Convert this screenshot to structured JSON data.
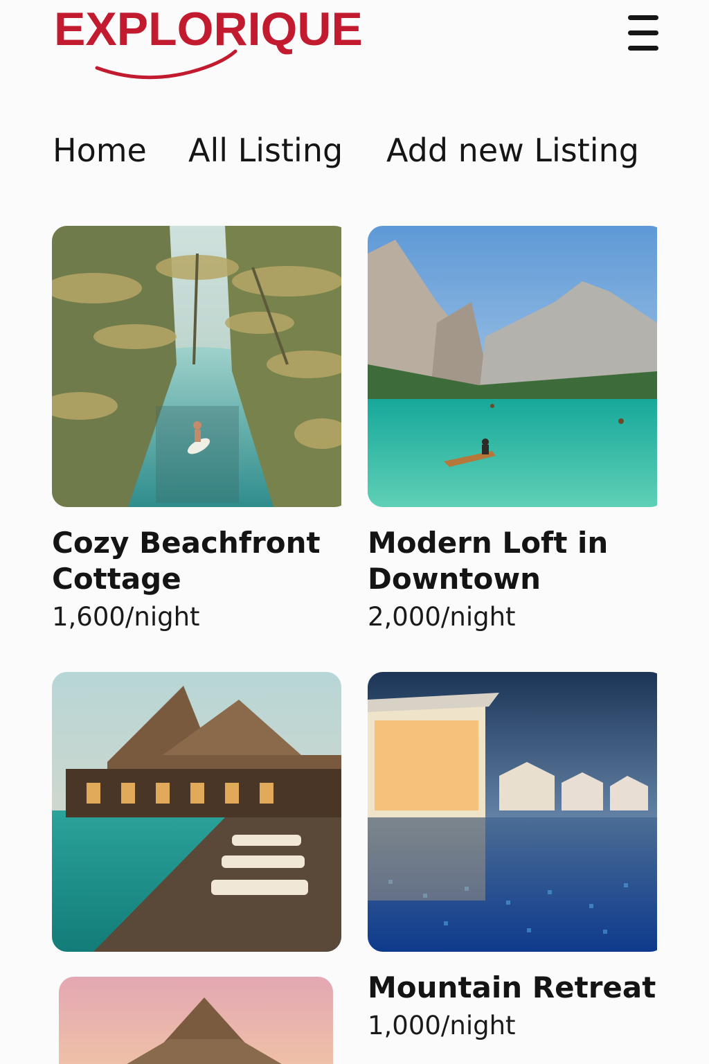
{
  "brand": {
    "name": "EXPLORIQUE",
    "color": "#c21a2f"
  },
  "header": {
    "menu_icon": "hamburger-menu-icon"
  },
  "nav": {
    "home": "Home",
    "all_listing": "All Listing",
    "add_listing": "Add new Listing"
  },
  "listings": [
    {
      "title": "Cozy Beachfront Cottage",
      "price": "1,600/night",
      "image": "palm-lagoon-kayak-photo"
    },
    {
      "title": "Modern Loft in Downtown",
      "price": "2,000/night",
      "image": "mountain-lake-boat-photo"
    },
    {
      "title": "",
      "price": "",
      "image": "overwater-villa-deck-loungers-photo"
    },
    {
      "title": "Mountain Retreat",
      "price": "1,000/night",
      "image": "modern-villa-infinity-pool-photo"
    },
    {
      "title": "",
      "price": "",
      "image": "thatched-roof-sunset-photo"
    }
  ]
}
